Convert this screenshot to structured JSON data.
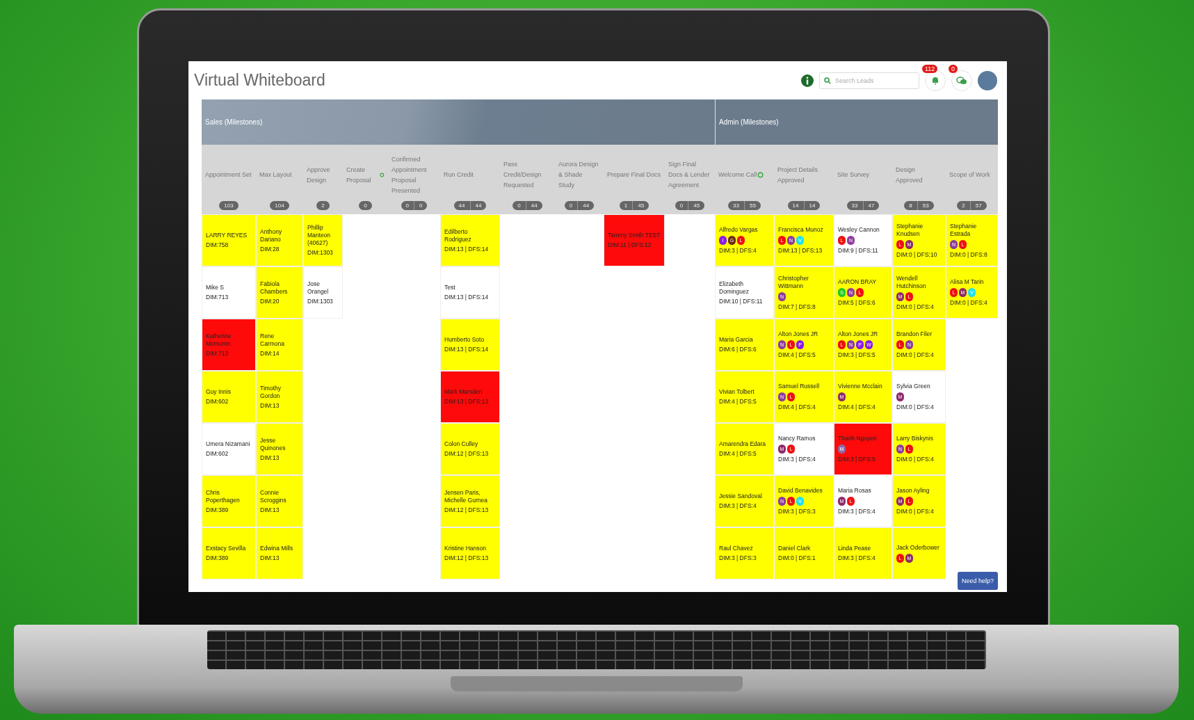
{
  "app": {
    "title": "Virtual Whiteboard",
    "search": {
      "placeholder": "Search Leads"
    },
    "notifications": {
      "count": "112"
    },
    "messages": {
      "count": "0"
    }
  },
  "groups": [
    {
      "title": "Sales (Milestones)",
      "columns": [
        {
          "label": "Appointment Set",
          "counts": [
            "103"
          ],
          "cards": [
            {
              "name": "LARRY REYES",
              "meta": "DIM:758",
              "color": "#ffff00"
            },
            {
              "name": "Mike S",
              "meta": "DIM:713",
              "color": "#ffffff"
            },
            {
              "name": "Katherine Mcmurrin",
              "meta": "DIM:713",
              "color": "#ff0a0a"
            },
            {
              "name": "Guy Innis",
              "meta": "DIM:602",
              "color": "#ffff00"
            },
            {
              "name": "Umera Nizamani",
              "meta": "DIM:602",
              "color": "#ffffff"
            },
            {
              "name": "Chris Poperthagen",
              "meta": "DIM:389",
              "color": "#ffff00"
            },
            {
              "name": "Exstacy Sevilla",
              "meta": "DIM:389",
              "color": "#ffff00"
            }
          ]
        },
        {
          "label": "Max Layout",
          "counts": [
            "104"
          ],
          "cards": [
            {
              "name": "Anthony Dariano",
              "meta": "DIM:28",
              "color": "#ffff00"
            },
            {
              "name": "Fabiola Chambers",
              "meta": "DIM:20",
              "color": "#ffff00"
            },
            {
              "name": "Rene Carmona",
              "meta": "DIM:14",
              "color": "#ffff00"
            },
            {
              "name": "Timothy Gordon",
              "meta": "DIM:13",
              "color": "#ffff00"
            },
            {
              "name": "Jesse Quinones",
              "meta": "DIM:13",
              "color": "#ffff00"
            },
            {
              "name": "Connie Scroggins",
              "meta": "DIM:13",
              "color": "#ffff00"
            },
            {
              "name": "Edwina Mills",
              "meta": "DIM:13",
              "color": "#ffff00"
            }
          ]
        },
        {
          "label": "Approve Design",
          "counts": [
            "2"
          ],
          "cards": [
            {
              "name": "Phillip Manteon (40627)",
              "meta": "DIM:1303",
              "color": "#ffff00"
            },
            {
              "name": "Jose Orangel",
              "meta": "DIM:1303",
              "color": "#ffffff"
            }
          ]
        },
        {
          "label": "Create Proposal",
          "refresh_icon": true,
          "counts": [
            "0"
          ]
        },
        {
          "label": "Confirmed Appointment Proposal Presented",
          "counts": [
            "0",
            "0"
          ]
        },
        {
          "label": "Run Credit",
          "counts": [
            "44",
            "44"
          ],
          "cards": [
            {
              "name": "Edilberto Rodriguez",
              "meta": "DIM:13 | DFS:14",
              "color": "#ffff00"
            },
            {
              "name": "Test",
              "meta": "DIM:13 | DFS:14",
              "color": "#ffffff"
            },
            {
              "name": "Humberto Soto",
              "meta": "DIM:13 | DFS:14",
              "color": "#ffff00"
            },
            {
              "name": "Mark Marsden",
              "meta": "DIM:13 | DFS:13",
              "color": "#ff0a0a"
            },
            {
              "name": "Colon Culley",
              "meta": "DIM:12 | DFS:13",
              "color": "#ffff00"
            },
            {
              "name": "Jensen Paris, Michelle Gurnea",
              "meta": "DIM:12 | DFS:13",
              "color": "#ffff00"
            },
            {
              "name": "Kristine Hanson",
              "meta": "DIM:12 | DFS:13",
              "color": "#ffff00"
            }
          ]
        },
        {
          "label": "Pass Credit/Design Requested",
          "counts": [
            "0",
            "44"
          ]
        },
        {
          "label": "Aurora Design & Shade Study",
          "counts": [
            "0",
            "44"
          ]
        },
        {
          "label": "Prepare Final Docs",
          "counts": [
            "1",
            "45"
          ],
          "cards": [
            {
              "name": "Tammy Smith TEST",
              "meta": "DIM:11 | DFS:12",
              "color": "#ff0a0a"
            }
          ]
        },
        {
          "label": "Sign Final Docs & Lender Agreement",
          "counts": [
            "0",
            "45"
          ]
        }
      ]
    },
    {
      "title": "Admin (Milestones)",
      "columns": [
        {
          "label": "Welcome Call",
          "refresh_icon": true,
          "counts": [
            "33",
            "55"
          ],
          "cards": [
            {
              "name": "Alfredo Vargas",
              "tags": [
                {
                  "letter": "I",
                  "color": "#8a1be6"
                },
                {
                  "letter": "G",
                  "color": "#6b2a0e"
                },
                {
                  "letter": "L",
                  "color": "#ee1111"
                }
              ],
              "meta": "DIM:3 | DFS:4",
              "color": "#ffff00"
            },
            {
              "name": "Elizabeth Dominguez",
              "meta": "DIM:10 | DFS:11",
              "color": "#ffffff"
            },
            {
              "name": "Maria Garcia",
              "meta": "DIM:6 | DFS:6",
              "color": "#ffff00"
            },
            {
              "name": "Vivian Tolbert",
              "meta": "DIM:4 | DFS:5",
              "color": "#ffff00"
            },
            {
              "name": "Amarendra Edara",
              "meta": "DIM:4 | DFS:5",
              "color": "#ffff00"
            },
            {
              "name": "Jessie Sandoval",
              "meta": "DIM:3 | DFS:4",
              "color": "#ffff00"
            },
            {
              "name": "Raul Chavez",
              "meta": "DIM:3 | DFS:3",
              "color": "#ffff00"
            }
          ]
        },
        {
          "label": "Project Details Approved",
          "counts": [
            "14",
            "14"
          ],
          "cards": [
            {
              "name": "Francisca Munoz",
              "tags": [
                {
                  "letter": "L",
                  "color": "#ee1111"
                },
                {
                  "letter": "N",
                  "color": "#8e3a9e"
                },
                {
                  "letter": "V",
                  "color": "#22e0f0"
                }
              ],
              "meta": "DIM:13 | DFS:13",
              "color": "#ffff00"
            },
            {
              "name": "Christopher Wittmann",
              "tags": [
                {
                  "letter": "N",
                  "color": "#8e3a9e"
                }
              ],
              "meta": "DIM:7 | DFS:8",
              "color": "#ffff00"
            },
            {
              "name": "Alton Jones JR",
              "tags": [
                {
                  "letter": "N",
                  "color": "#8e3a9e"
                },
                {
                  "letter": "L",
                  "color": "#ee1111"
                },
                {
                  "letter": "P",
                  "color": "#8a1be6"
                }
              ],
              "meta": "DIM:4 | DFS:5",
              "color": "#ffff00"
            },
            {
              "name": "Samuel Russell",
              "tags": [
                {
                  "letter": "N",
                  "color": "#8e3a9e"
                },
                {
                  "letter": "L",
                  "color": "#ee1111"
                }
              ],
              "meta": "DIM:4 | DFS:4",
              "color": "#ffff00"
            },
            {
              "name": "Nancy Ramos",
              "tags": [
                {
                  "letter": "M",
                  "color": "#8e2a6a"
                },
                {
                  "letter": "L",
                  "color": "#ee1111"
                }
              ],
              "meta": "DIM:3 | DFS:4",
              "color": "#ffffff"
            },
            {
              "name": "David Benavides",
              "tags": [
                {
                  "letter": "N",
                  "color": "#8e3a9e"
                },
                {
                  "letter": "L",
                  "color": "#ee1111"
                },
                {
                  "letter": "V",
                  "color": "#22e0f0"
                }
              ],
              "meta": "DIM:3 | DFS:3",
              "color": "#ffff00"
            },
            {
              "name": "Daniel Clark",
              "meta": "DIM:0 | DFS:1",
              "color": "#ffff00"
            }
          ]
        },
        {
          "label": "Site Survey",
          "counts": [
            "33",
            "47"
          ],
          "cards": [
            {
              "name": "Wesley Cannon",
              "tags": [
                {
                  "letter": "L",
                  "color": "#ee1111"
                },
                {
                  "letter": "N",
                  "color": "#8e3a9e"
                }
              ],
              "meta": "DIM:9 | DFS:11",
              "color": "#ffffff"
            },
            {
              "name": "AARON BRAY",
              "tags": [
                {
                  "letter": "S",
                  "color": "#22cc22"
                },
                {
                  "letter": "N",
                  "color": "#8e3a9e"
                },
                {
                  "letter": "L",
                  "color": "#ee1111"
                }
              ],
              "meta": "DIM:5 | DFS:6",
              "color": "#ffff00"
            },
            {
              "name": "Alton Jones JR",
              "tags": [
                {
                  "letter": "L",
                  "color": "#ee1111"
                },
                {
                  "letter": "N",
                  "color": "#8e3a9e"
                },
                {
                  "letter": "P",
                  "color": "#8a1be6"
                },
                {
                  "letter": "W",
                  "color": "#8a1be6"
                }
              ],
              "meta": "DIM:3 | DFS:5",
              "color": "#ffff00"
            },
            {
              "name": "Vivienne Mcclain",
              "tags": [
                {
                  "letter": "M",
                  "color": "#8e2a6a"
                }
              ],
              "meta": "DIM:4 | DFS:4",
              "color": "#ffff00"
            },
            {
              "name": "Thanh Nguyen",
              "tags": [
                {
                  "letter": "M",
                  "color": "#8e6aa8"
                }
              ],
              "meta": "DIM:3 | DFS:5",
              "color": "#ff0a0a"
            },
            {
              "name": "Maria Rosas",
              "tags": [
                {
                  "letter": "M",
                  "color": "#8e2a6a"
                },
                {
                  "letter": "L",
                  "color": "#ee1111"
                }
              ],
              "meta": "DIM:3 | DFS:4",
              "color": "#ffffff"
            },
            {
              "name": "Linda Pease",
              "meta": "DIM:3 | DFS:4",
              "color": "#ffff00"
            }
          ]
        },
        {
          "label": "Design Approved",
          "counts": [
            "8",
            "53"
          ],
          "cards": [
            {
              "name": "Stephanie Knudsen",
              "tags": [
                {
                  "letter": "L",
                  "color": "#ee1111"
                },
                {
                  "letter": "M",
                  "color": "#8e2a6a"
                }
              ],
              "meta": "DIM:0 | DFS:10",
              "color": "#ffff00"
            },
            {
              "name": "Wendell Hutchinson",
              "tags": [
                {
                  "letter": "M",
                  "color": "#8e2a6a"
                },
                {
                  "letter": "L",
                  "color": "#ee1111"
                }
              ],
              "meta": "DIM:0 | DFS:4",
              "color": "#ffff00"
            },
            {
              "name": "Brandon Filer",
              "tags": [
                {
                  "letter": "L",
                  "color": "#ee1111"
                },
                {
                  "letter": "N",
                  "color": "#8e3a9e"
                }
              ],
              "meta": "DIM:0 | DFS:4",
              "color": "#ffff00"
            },
            {
              "name": "Sylvia Green",
              "tags": [
                {
                  "letter": "M",
                  "color": "#8e2a6a"
                }
              ],
              "meta": "DIM:0 | DFS:4",
              "color": "#ffffff"
            },
            {
              "name": "Larry Biskynis",
              "tags": [
                {
                  "letter": "N",
                  "color": "#8e3a9e"
                },
                {
                  "letter": "L",
                  "color": "#ee1111"
                }
              ],
              "meta": "DIM:0 | DFS:4",
              "color": "#ffff00"
            },
            {
              "name": "Jason Ayling",
              "tags": [
                {
                  "letter": "M",
                  "color": "#8e2a6a"
                },
                {
                  "letter": "L",
                  "color": "#ee1111"
                }
              ],
              "meta": "DIM:0 | DFS:4",
              "color": "#ffff00"
            },
            {
              "name": "Jack Oderbower",
              "tags": [
                {
                  "letter": "L",
                  "color": "#ee1111"
                },
                {
                  "letter": "M",
                  "color": "#8e2a6a"
                }
              ],
              "color": "#ffff00"
            }
          ]
        },
        {
          "label": "Scope of Work",
          "counts": [
            "2",
            "57"
          ],
          "cards": [
            {
              "name": "Stephanie Estrada",
              "tags": [
                {
                  "letter": "N",
                  "color": "#8e3a9e"
                },
                {
                  "letter": "L",
                  "color": "#ee1111"
                }
              ],
              "meta": "DIM:0 | DFS:8",
              "color": "#ffff00"
            },
            {
              "name": "Alisa M Tarin",
              "tags": [
                {
                  "letter": "L",
                  "color": "#ee1111"
                },
                {
                  "letter": "M",
                  "color": "#8e2a6a"
                },
                {
                  "letter": "V",
                  "color": "#22e0f0"
                }
              ],
              "meta": "DIM:0 | DFS:4",
              "color": "#ffff00"
            }
          ]
        }
      ]
    }
  ],
  "help_button": "Need help?"
}
